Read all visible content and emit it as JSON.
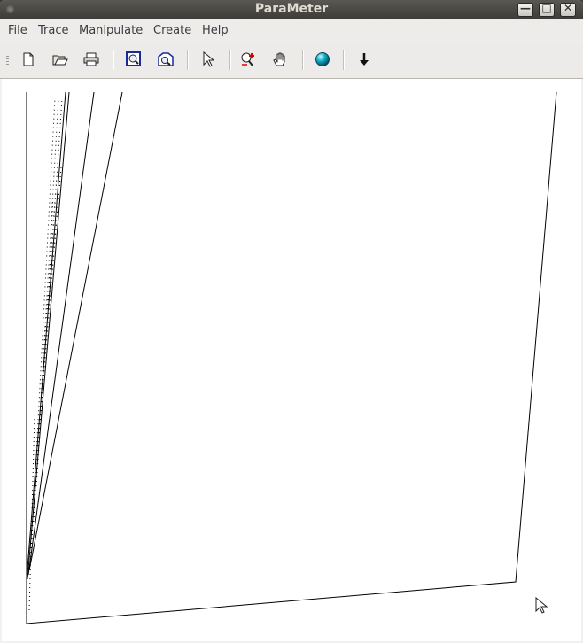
{
  "window": {
    "title": "ParaMeter",
    "controls": {
      "minimize": "—",
      "maximize": "□",
      "close": "✕"
    }
  },
  "menu": [
    "File",
    "Trace",
    "Manipulate",
    "Create",
    "Help"
  ],
  "toolbar": [
    {
      "name": "new-file-icon"
    },
    {
      "name": "open-folder-icon"
    },
    {
      "name": "print-icon"
    },
    {
      "name": "zoom-fit-icon"
    },
    {
      "name": "zoom-region-icon"
    },
    {
      "name": "pointer-select-icon"
    },
    {
      "name": "zoom-in-icon"
    },
    {
      "name": "hand-pan-icon"
    },
    {
      "name": "globe-icon"
    },
    {
      "name": "arrow-down-icon"
    }
  ],
  "colors": {
    "titlebar": "#3c3b37",
    "canvas": "#ffffff",
    "trace": "#000000"
  }
}
